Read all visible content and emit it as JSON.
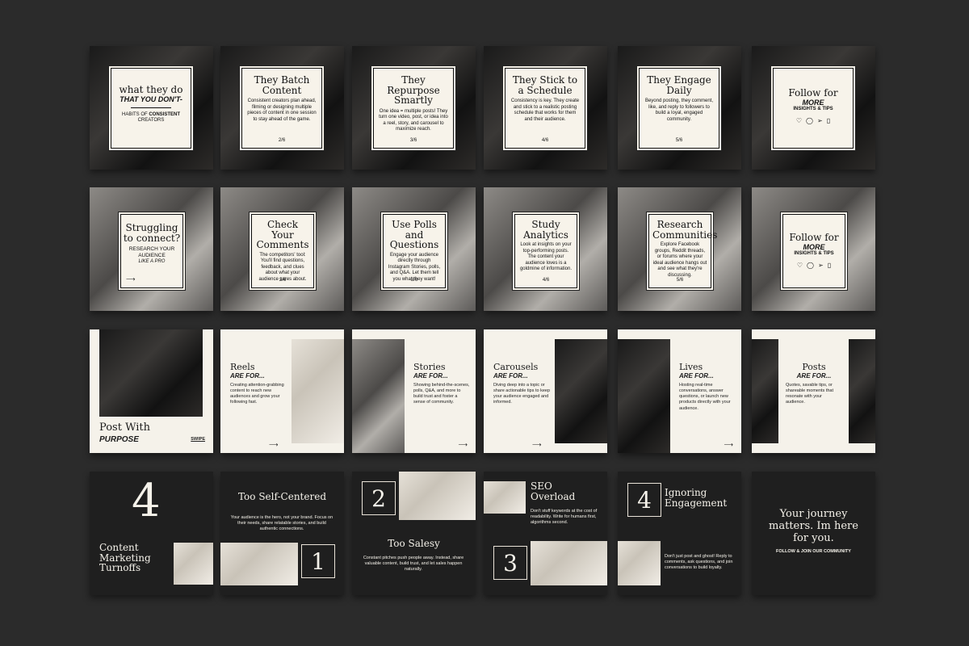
{
  "colors": {
    "background": "#2b2b2b",
    "cream": "#f7f3ea",
    "dark": "#1f1f1f",
    "ink": "#111111"
  },
  "row1": [
    {
      "title": "what they do",
      "em": "THAT YOU DON'T-",
      "sub1": "HABITS OF",
      "sub_strong": "CONSISTENT",
      "sub2": "CREATORS"
    },
    {
      "title": "They Batch Content",
      "body": "Consistent creators plan ahead, filming or designing multiple pieces of content in one session to stay ahead of the game.",
      "page": "2/6"
    },
    {
      "title": "They Repurpose Smartly",
      "body": "One idea = multiple posts! They turn one video, post, or idea into a reel, story, and carousel to maximize reach.",
      "page": "3/6"
    },
    {
      "title": "They Stick to a Schedule",
      "body": "Consistency is key. They create and stick to a realistic posting schedule that works for them and their audience.",
      "page": "4/6"
    },
    {
      "title": "They Engage Daily",
      "body": "Beyond posting, they comment, like, and reply to followers to build a loyal, engaged community.",
      "page": "5/6"
    },
    {
      "title": "Follow for",
      "em": "MORE",
      "sub": "INSIGHTS & TIPS",
      "icons": [
        "heart-icon",
        "comment-icon",
        "send-icon",
        "bookmark-icon"
      ]
    }
  ],
  "row2": [
    {
      "title": "Struggling to connect?",
      "sub": "RESEARCH YOUR AUDIENCE",
      "em": "LIKE A PRO",
      "arrow": "⟶"
    },
    {
      "title": "Check Your Comments",
      "body": "The competitors' tool: You'll find questions, feedback, and clues about what your audience cares about.",
      "page": "2/6"
    },
    {
      "title": "Use Polls and Questions",
      "body": "Engage your audience directly through Instagram Stories, polls, and Q&A. Let them tell you what they want!",
      "page": "3/6"
    },
    {
      "title": "Study Analytics",
      "body": "Look at insights on your top-performing posts. The content your audience loves is a goldmine of information.",
      "page": "4/6"
    },
    {
      "title": "Research Communities",
      "body": "Explore Facebook groups, Reddit threads, or forums where your ideal audience hangs out and see what they're discussing.",
      "page": "5/6"
    },
    {
      "title": "Follow for",
      "em": "MORE",
      "sub": "INSIGHTS & TIPS"
    }
  ],
  "row3": [
    {
      "title": "Post With",
      "em": "PURPOSE",
      "swipe": "SWIPE"
    },
    {
      "title": "Reels",
      "em": "ARE FOR...",
      "body": "Creating attention-grabbing content to reach new audiences and grow your following fast.",
      "arrow": "⟶"
    },
    {
      "title": "Stories",
      "em": "ARE FOR...",
      "body": "Showing behind-the-scenes, polls, Q&A, and more to build trust and foster a sense of community.",
      "arrow": "⟶"
    },
    {
      "title": "Carousels",
      "em": "ARE FOR...",
      "body": "Diving deep into a topic or share actionable tips to keep your audience engaged and informed.",
      "arrow": "⟶"
    },
    {
      "title": "Lives",
      "em": "ARE FOR...",
      "body": "Hosting real-time conversations, answer questions, or launch new products directly with your audience.",
      "arrow": "⟶"
    },
    {
      "title": "Posts",
      "em": "ARE FOR...",
      "body": "Quotes, savable tips, or shareable moments that resonate with your audience."
    }
  ],
  "row4": {
    "t1": {
      "num": "4",
      "title": "Content Marketing Turnoffs"
    },
    "t2": {
      "title": "Too Self-Centered",
      "body": "Your audience is the hero, not your brand. Focus on their needs, share relatable stories, and build authentic connections.",
      "num": "1"
    },
    "t3": {
      "num": "2",
      "title": "Too Salesy",
      "body": "Constant pitches push people away. Instead, share valuable content, build trust, and let sales happen naturally."
    },
    "t4": {
      "title": "SEO Overload",
      "body": "Don't stuff keywords at the cost of readability. Write for humans first, algorithms second.",
      "num": "3"
    },
    "t5": {
      "num": "4",
      "title": "Ignoring Engagement",
      "body": "Don't just post and ghost! Reply to comments, ask questions, and join conversations to build loyalty."
    },
    "t6": {
      "title": "Your journey matters. Im here for you.",
      "sub": "FOLLOW & JOIN OUR COMMUNITY"
    }
  }
}
